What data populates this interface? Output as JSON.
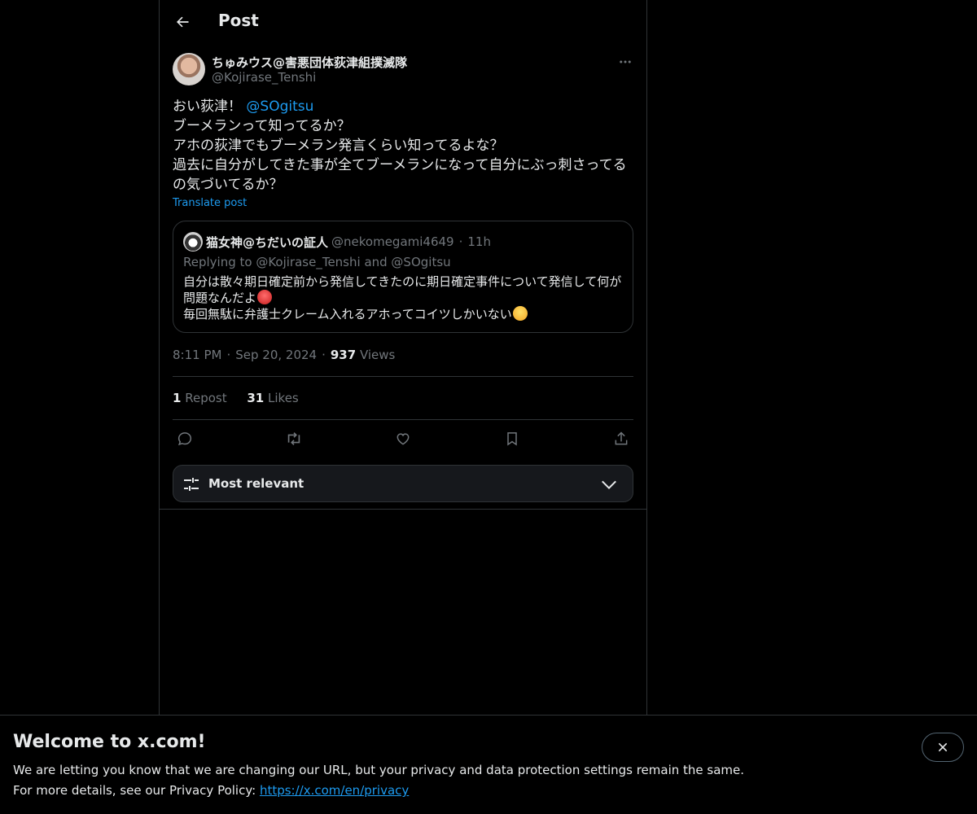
{
  "header": {
    "title": "Post"
  },
  "author": {
    "name": "ちゅみウス@害悪団体荻津組撲滅隊",
    "handle": "@Kojirase_Tenshi"
  },
  "tweet": {
    "line1_text": "おい荻津！ ",
    "line1_mention": "@SOgitsu",
    "line2": "ブーメランって知ってるか？",
    "line3": "アホの荻津でもブーメラン発言くらい知ってるよな？",
    "line4": "過去に自分がしてきた事が全てブーメランになって自分にぶっ刺さってる",
    "line5": "の気づいてるか？",
    "translate_label": "Translate post"
  },
  "quote": {
    "name": "猫女神@ちだいの証人",
    "handle": "@nekomegami4649",
    "separator": "·",
    "time": "11h",
    "replying": "Replying to @Kojirase_Tenshi and @SOgitsu",
    "line1": "自分は散々期日確定前から発信してきたのに期日確定事件について発信して何が",
    "line2": "問題なんだよ",
    "line3": "毎回無駄に弁護士クレーム入れるアホってコイツしかいない",
    "emoji1": "angry-face-emoji",
    "emoji2": "laughing-tears-emoji"
  },
  "meta": {
    "time": "8:11 PM",
    "separator": "·",
    "date": "Sep 20, 2024",
    "views_count": "937",
    "views_label": "Views"
  },
  "stats": {
    "reposts_count": "1",
    "reposts_label": "Repost",
    "likes_count": "31",
    "likes_label": "Likes"
  },
  "actions": [
    "reply-icon",
    "repost-icon",
    "like-icon",
    "bookmark-icon",
    "share-icon"
  ],
  "sort": {
    "label": "Most relevant"
  },
  "banner": {
    "title": "Welcome to x.com!",
    "line1": "We are letting you know that we are changing our URL, but your privacy and data protection settings remain the same.",
    "line2_prefix": "For more details, see our Privacy Policy: ",
    "link": "https://x.com/en/privacy"
  },
  "colors": {
    "background": "#000000",
    "text": "#e7e9ea",
    "muted": "#71767b",
    "accent": "#1d9bf0",
    "border": "#2f3336"
  }
}
